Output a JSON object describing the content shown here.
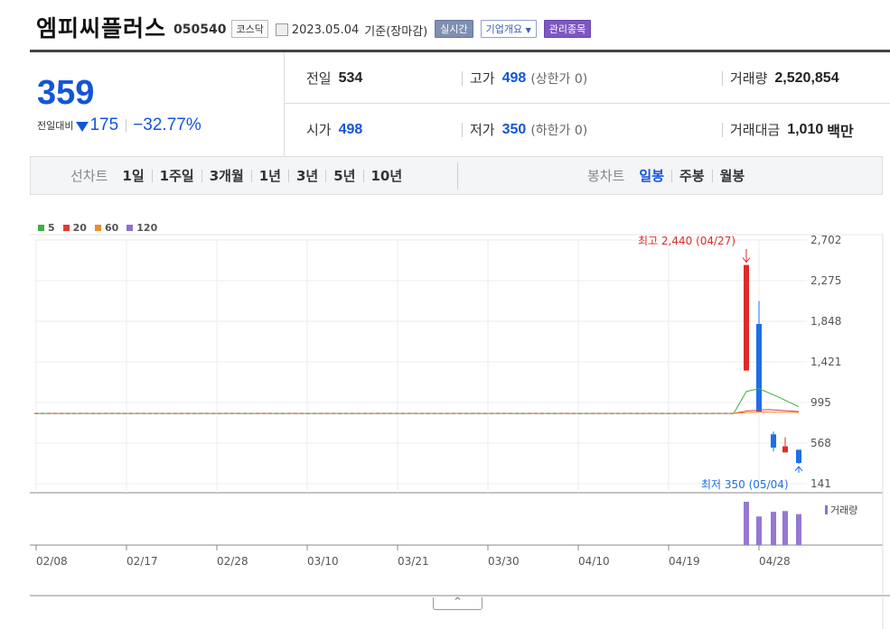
{
  "header": {
    "name": "엠피씨플러스",
    "code": "050540",
    "market": "코스닥",
    "date": "2023.05.04",
    "basis": "기준(장마감)",
    "realtime_label": "실시간",
    "company_info_label": "기업개요",
    "watch_label": "관리종목"
  },
  "summary": {
    "price": "359",
    "change_label": "전일대비",
    "change_amount": "175",
    "change_rate": "−32.77%",
    "direction": "down",
    "prev_close_label": "전일",
    "prev_close": "534",
    "high_label": "고가",
    "high": "498",
    "upper_limit": "(상한가 0)",
    "volume_label": "거래량",
    "volume": "2,520,854",
    "open_label": "시가",
    "open": "498",
    "low_label": "저가",
    "low": "350",
    "lower_limit": "(하한가 0)",
    "amount_label": "거래대금",
    "amount": "1,010",
    "amount_unit": "백만"
  },
  "tabs": {
    "line_label": "선차트",
    "line_items": [
      "1일",
      "1주일",
      "3개월",
      "1년",
      "3년",
      "5년",
      "10년"
    ],
    "candle_label": "봉차트",
    "candle_items": [
      "일봉",
      "주봉",
      "월봉"
    ],
    "candle_active": "일봉"
  },
  "chart_data": {
    "type": "candlestick",
    "legend": [
      {
        "name": "5",
        "color": "#3db13d"
      },
      {
        "name": "20",
        "color": "#e03b3b"
      },
      {
        "name": "60",
        "color": "#f08a28"
      },
      {
        "name": "120",
        "color": "#8e6fcf"
      }
    ],
    "y_ticks": [
      "2,702",
      "2,275",
      "1,848",
      "1,421",
      "995",
      "568",
      "141"
    ],
    "ylim": [
      141,
      2702
    ],
    "x_ticks": [
      "02/08",
      "02/17",
      "02/28",
      "03/10",
      "03/21",
      "03/30",
      "04/10",
      "04/19",
      "04/28"
    ],
    "flat_price": 880,
    "candles": [
      {
        "date": "04/27",
        "open": 1330,
        "close": 2440,
        "high": 2440,
        "low": 1330,
        "color": "up"
      },
      {
        "date": "04/28",
        "open": 1820,
        "close": 900,
        "high": 2060,
        "low": 900,
        "color": "down"
      },
      {
        "date": "05/02",
        "open": 660,
        "close": 520,
        "high": 690,
        "low": 480,
        "color": "down"
      },
      {
        "date": "05/03",
        "open": 534,
        "close": 470,
        "high": 630,
        "low": 470,
        "color": "up"
      },
      {
        "date": "05/04",
        "open": 498,
        "close": 359,
        "high": 498,
        "low": 350,
        "color": "down"
      }
    ],
    "ma5": [
      880,
      1110,
      1140,
      1050,
      950
    ],
    "volumes": [
      5.6,
      3.7,
      4.3,
      4.4,
      4.0
    ],
    "high_annotation": "최고 2,440 (04/27)",
    "low_annotation": "최저 350 (05/04)",
    "volume_legend": "거래량"
  },
  "toggle_label": "^"
}
